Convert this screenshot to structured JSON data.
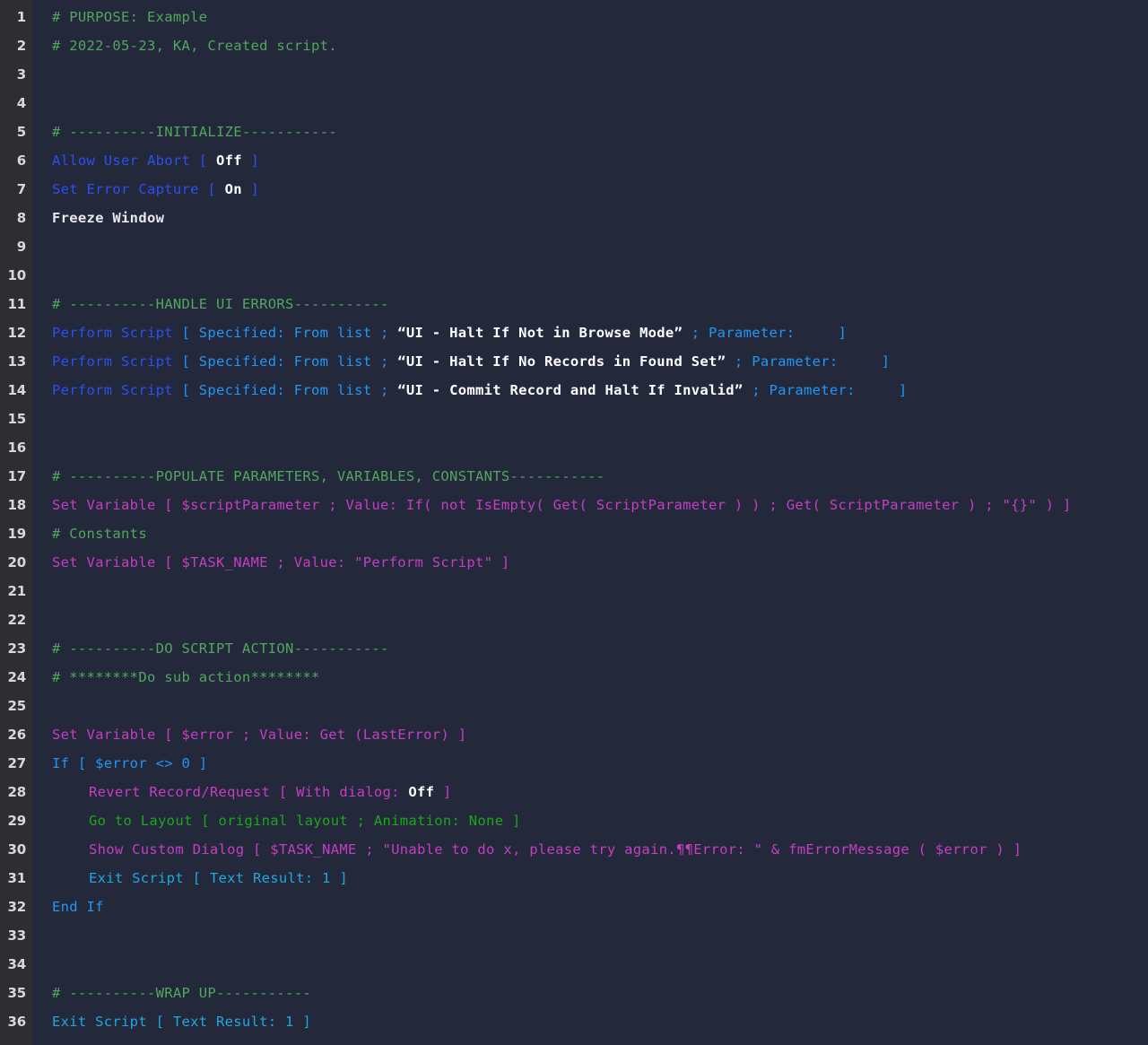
{
  "editor": {
    "title": "FileMaker Script Workspace",
    "theme": {
      "background": "#24283b",
      "gutter_background": "#2e2e32",
      "gutter_text": "#d8d8dc",
      "comment_green": "#4fa85c",
      "step_green": "#18a818",
      "step_blue": "#2b50ef",
      "step_cyan": "#2196f3",
      "step_magenta": "#c43ec4",
      "value_white": "#ffffff"
    },
    "first_line": 1,
    "last_line": 36,
    "total_lines": 36
  },
  "lines": [
    {
      "n": "1",
      "indent": 0,
      "tokens": [
        {
          "c": "t-comment",
          "t": "# PURPOSE: Example"
        }
      ]
    },
    {
      "n": "2",
      "indent": 0,
      "tokens": [
        {
          "c": "t-comment",
          "t": "# 2022-05-23, KA, Created script."
        }
      ]
    },
    {
      "n": "3",
      "indent": 0,
      "tokens": []
    },
    {
      "n": "4",
      "indent": 0,
      "tokens": []
    },
    {
      "n": "5",
      "indent": 0,
      "tokens": [
        {
          "c": "t-comment",
          "t": "# ----------INITIALIZE-----------"
        }
      ]
    },
    {
      "n": "6",
      "indent": 0,
      "tokens": [
        {
          "c": "t-blue",
          "t": "Allow User Abort [ "
        },
        {
          "c": "t-boldwhite",
          "t": "Off"
        },
        {
          "c": "t-blue",
          "t": " ]"
        }
      ]
    },
    {
      "n": "7",
      "indent": 0,
      "tokens": [
        {
          "c": "t-blue",
          "t": "Set Error Capture [ "
        },
        {
          "c": "t-boldwhite",
          "t": "On"
        },
        {
          "c": "t-blue",
          "t": " ]"
        }
      ]
    },
    {
      "n": "8",
      "indent": 0,
      "tokens": [
        {
          "c": "t-plain",
          "t": "Freeze Window"
        }
      ]
    },
    {
      "n": "9",
      "indent": 0,
      "tokens": []
    },
    {
      "n": "10",
      "indent": 0,
      "tokens": []
    },
    {
      "n": "11",
      "indent": 0,
      "tokens": [
        {
          "c": "t-comment",
          "t": "# ----------HANDLE UI ERRORS-----------"
        }
      ]
    },
    {
      "n": "12",
      "indent": 0,
      "tokens": [
        {
          "c": "t-blue",
          "t": "Perform Script "
        },
        {
          "c": "t-cyan",
          "t": "[ Specified: From list ; "
        },
        {
          "c": "t-boldwhite",
          "t": "“UI - Halt If Not in Browse Mode”"
        },
        {
          "c": "t-cyan",
          "t": " ; Parameter:     ]"
        }
      ]
    },
    {
      "n": "13",
      "indent": 0,
      "tokens": [
        {
          "c": "t-blue",
          "t": "Perform Script "
        },
        {
          "c": "t-cyan",
          "t": "[ Specified: From list ; "
        },
        {
          "c": "t-boldwhite",
          "t": "“UI - Halt If No Records in Found Set”"
        },
        {
          "c": "t-cyan",
          "t": " ; Parameter:     ]"
        }
      ]
    },
    {
      "n": "14",
      "indent": 0,
      "tokens": [
        {
          "c": "t-blue",
          "t": "Perform Script "
        },
        {
          "c": "t-cyan",
          "t": "[ Specified: From list ; "
        },
        {
          "c": "t-boldwhite",
          "t": "“UI - Commit Record and Halt If Invalid”"
        },
        {
          "c": "t-cyan",
          "t": " ; Parameter:     ]"
        }
      ]
    },
    {
      "n": "15",
      "indent": 0,
      "tokens": []
    },
    {
      "n": "16",
      "indent": 0,
      "tokens": []
    },
    {
      "n": "17",
      "indent": 0,
      "tokens": [
        {
          "c": "t-comment",
          "t": "# ----------POPULATE PARAMETERS, VARIABLES, CONSTANTS-----------"
        }
      ]
    },
    {
      "n": "18",
      "indent": 0,
      "tokens": [
        {
          "c": "t-magenta",
          "t": "Set Variable [ $scriptParameter ; Value: If( not IsEmpty( Get( ScriptParameter ) ) ; Get( ScriptParameter ) ; \"{}\" ) ]"
        }
      ]
    },
    {
      "n": "19",
      "indent": 0,
      "tokens": [
        {
          "c": "t-comment",
          "t": "# Constants"
        }
      ]
    },
    {
      "n": "20",
      "indent": 0,
      "tokens": [
        {
          "c": "t-magenta",
          "t": "Set Variable [ $TASK_NAME ; Value: \"Perform Script\" ]"
        }
      ]
    },
    {
      "n": "21",
      "indent": 0,
      "tokens": []
    },
    {
      "n": "22",
      "indent": 0,
      "tokens": []
    },
    {
      "n": "23",
      "indent": 0,
      "tokens": [
        {
          "c": "t-comment",
          "t": "# ----------DO SCRIPT ACTION-----------"
        }
      ]
    },
    {
      "n": "24",
      "indent": 0,
      "tokens": [
        {
          "c": "t-comment",
          "t": "# ********Do sub action********"
        }
      ]
    },
    {
      "n": "25",
      "indent": 0,
      "tokens": []
    },
    {
      "n": "26",
      "indent": 0,
      "tokens": [
        {
          "c": "t-magenta",
          "t": "Set Variable [ $error ; Value: Get (LastError) ]"
        }
      ]
    },
    {
      "n": "27",
      "indent": 0,
      "tokens": [
        {
          "c": "t-cyan",
          "t": "If [ $error <> 0 ]"
        }
      ]
    },
    {
      "n": "28",
      "indent": 1,
      "tokens": [
        {
          "c": "t-magenta",
          "t": "Revert Record/Request [ With dialog: "
        },
        {
          "c": "t-boldwhite",
          "t": "Off"
        },
        {
          "c": "t-magenta",
          "t": " ]"
        }
      ]
    },
    {
      "n": "29",
      "indent": 1,
      "tokens": [
        {
          "c": "t-green",
          "t": "Go to Layout [ original layout ; Animation: None ]"
        }
      ]
    },
    {
      "n": "30",
      "indent": 1,
      "tokens": [
        {
          "c": "t-magenta",
          "t": "Show Custom Dialog [ $TASK_NAME ; \"Unable to do x, please try again.¶¶Error: \" & fmErrorMessage ( $error ) ]"
        }
      ]
    },
    {
      "n": "31",
      "indent": 1,
      "tokens": [
        {
          "c": "t-cyan2",
          "t": "Exit Script [ Text Result: 1 ]"
        }
      ]
    },
    {
      "n": "32",
      "indent": 0,
      "tokens": [
        {
          "c": "t-cyan",
          "t": "End If"
        }
      ]
    },
    {
      "n": "33",
      "indent": 0,
      "tokens": []
    },
    {
      "n": "34",
      "indent": 0,
      "tokens": []
    },
    {
      "n": "35",
      "indent": 0,
      "tokens": [
        {
          "c": "t-comment",
          "t": "# ----------WRAP UP-----------"
        }
      ]
    },
    {
      "n": "36",
      "indent": 0,
      "tokens": [
        {
          "c": "t-cyan2",
          "t": "Exit Script [ Text Result: 1 ]"
        }
      ]
    }
  ]
}
